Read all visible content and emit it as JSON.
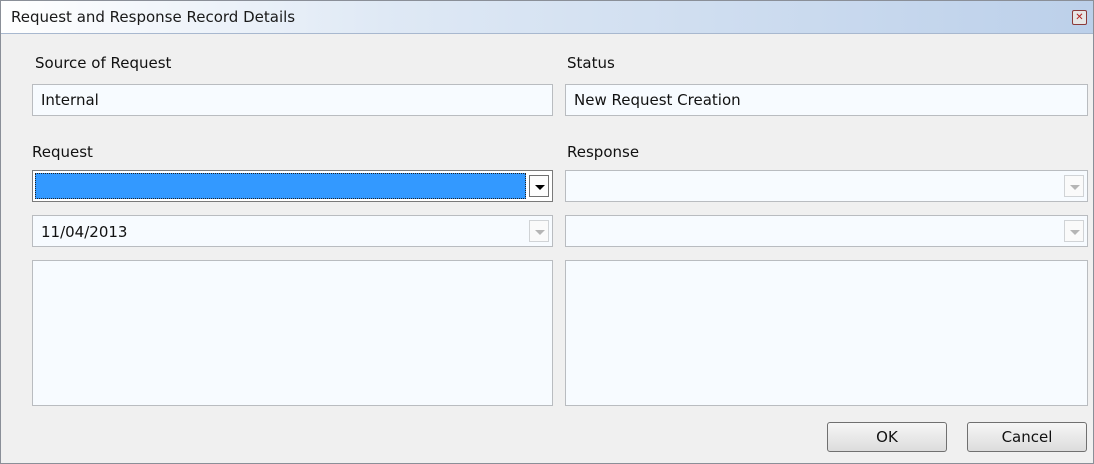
{
  "window": {
    "title": "Request and Response Record Details"
  },
  "source": {
    "label": "Source of Request",
    "value": "Internal"
  },
  "status": {
    "label": "Status",
    "value": "New Request Creation"
  },
  "request": {
    "label": "Request",
    "type_value": "",
    "date_value": "11/04/2013",
    "notes": ""
  },
  "response": {
    "label": "Response",
    "type_value": "",
    "date_value": "",
    "notes": ""
  },
  "buttons": {
    "ok": "OK",
    "cancel": "Cancel"
  },
  "colors": {
    "selection": "#3399ff",
    "field_bg": "#f7fbff"
  }
}
